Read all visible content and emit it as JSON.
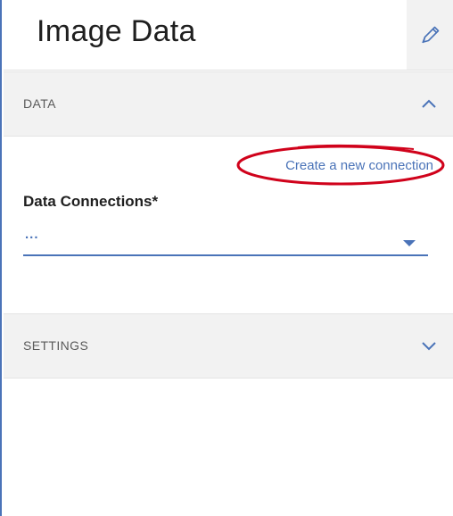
{
  "panel": {
    "title": "Image Data",
    "edit_icon": "pencil-icon"
  },
  "sections": {
    "data": {
      "label": "DATA",
      "expanded": true,
      "toggle_icon": "chevron-up-icon"
    },
    "settings": {
      "label": "SETTINGS",
      "expanded": false,
      "toggle_icon": "chevron-down-icon"
    }
  },
  "data_connections": {
    "create_link": "Create a new connection",
    "label": "Data Connections*",
    "selected_value": "...",
    "dropdown_icon": "caret-down-icon"
  },
  "colors": {
    "accent": "#4a73b8",
    "section_bg": "#f2f2f2",
    "annotation": "#d0021b"
  }
}
